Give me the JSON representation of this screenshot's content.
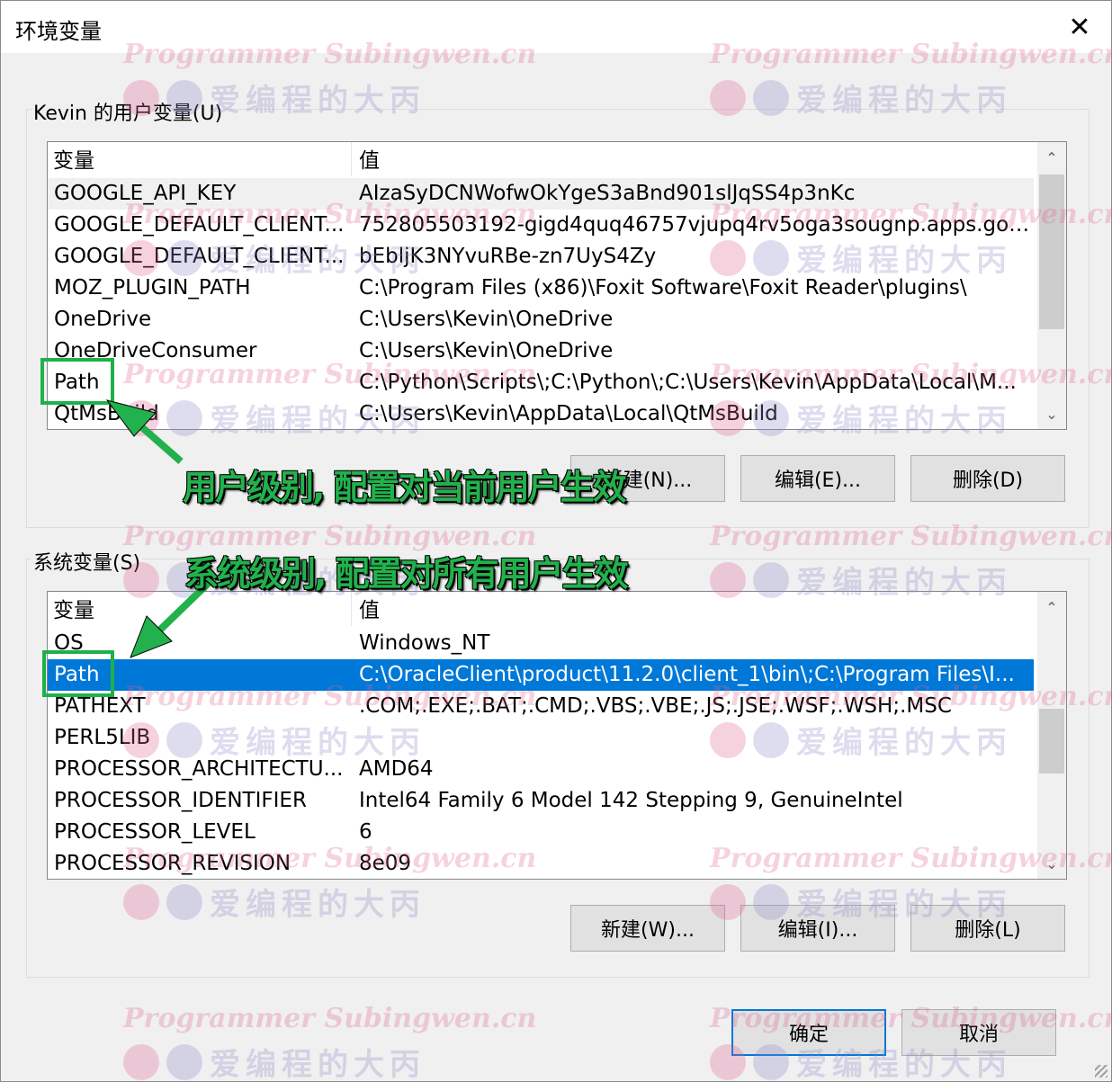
{
  "window": {
    "title": "环境变量",
    "close_glyph": "✕"
  },
  "user_vars": {
    "group_label": "Kevin 的用户变量(U)",
    "col_var": "变量",
    "col_val": "值",
    "rows": [
      {
        "name": "GOOGLE_API_KEY",
        "value": "AIzaSyDCNWofwOkYgeS3aBnd901slJqSS4p3nKc"
      },
      {
        "name": "GOOGLE_DEFAULT_CLIENT...",
        "value": "752805503192-gigd4quq46757vjupq4rv5oga3sougnp.apps.goo..."
      },
      {
        "name": "GOOGLE_DEFAULT_CLIENT...",
        "value": "bEbljK3NYvuRBe-zn7UyS4Zy"
      },
      {
        "name": "MOZ_PLUGIN_PATH",
        "value": "C:\\Program Files (x86)\\Foxit Software\\Foxit Reader\\plugins\\"
      },
      {
        "name": "OneDrive",
        "value": "C:\\Users\\Kevin\\OneDrive"
      },
      {
        "name": "OneDriveConsumer",
        "value": "C:\\Users\\Kevin\\OneDrive"
      },
      {
        "name": "Path",
        "value": "C:\\Python\\Scripts\\;C:\\Python\\;C:\\Users\\Kevin\\AppData\\Local\\M..."
      },
      {
        "name": "QtMsBuild",
        "value": "C:\\Users\\Kevin\\AppData\\Local\\QtMsBuild"
      }
    ],
    "buttons": {
      "new": "新建(N)...",
      "edit": "编辑(E)...",
      "delete": "删除(D)"
    }
  },
  "system_vars": {
    "group_label": "系统变量(S)",
    "col_var": "变量",
    "col_val": "值",
    "rows": [
      {
        "name": "OS",
        "value": "Windows_NT"
      },
      {
        "name": "Path",
        "value": "C:\\OracleClient\\product\\11.2.0\\client_1\\bin\\;C:\\Program Files\\I..."
      },
      {
        "name": "PATHEXT",
        "value": ".COM;.EXE;.BAT;.CMD;.VBS;.VBE;.JS;.JSE;.WSF;.WSH;.MSC"
      },
      {
        "name": "PERL5LIB",
        "value": ""
      },
      {
        "name": "PROCESSOR_ARCHITECTU...",
        "value": "AMD64"
      },
      {
        "name": "PROCESSOR_IDENTIFIER",
        "value": "Intel64 Family 6 Model 142 Stepping 9, GenuineIntel"
      },
      {
        "name": "PROCESSOR_LEVEL",
        "value": "6"
      },
      {
        "name": "PROCESSOR_REVISION",
        "value": "8e09"
      }
    ],
    "selected_index": 1,
    "buttons": {
      "new": "新建(W)...",
      "edit": "编辑(I)...",
      "delete": "删除(L)"
    }
  },
  "footer": {
    "ok": "确定",
    "cancel": "取消"
  },
  "annotations": {
    "user_note": "用户级别, 配置对当前用户生效",
    "system_note": "系统级别, 配置对所有用户生效",
    "color": "#22b14c"
  },
  "watermark": {
    "line1": "Programmer Subingwen.cn",
    "line2": "爱编程的大丙"
  },
  "scroll_glyphs": {
    "up": "⌃",
    "down": "⌄"
  }
}
